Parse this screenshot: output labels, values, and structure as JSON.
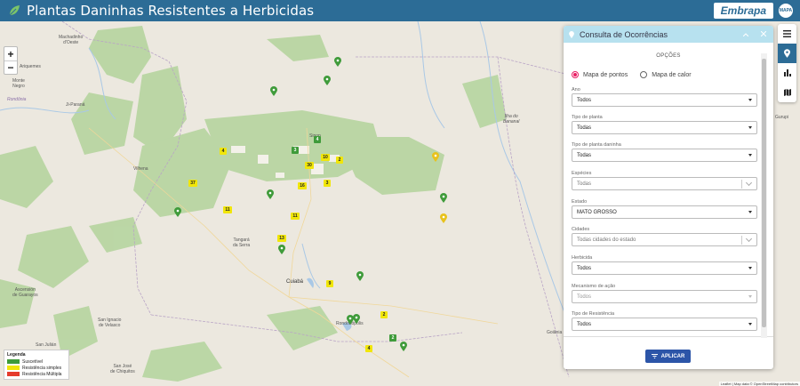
{
  "header": {
    "title": "Plantas Daninhas Resistentes a Herbicidas",
    "brand": "Embrapa",
    "gov_logo": "MAPA"
  },
  "map": {
    "zoom_in": "+",
    "zoom_out": "−",
    "places": [
      {
        "name": "Machadinho\nd'Oeste",
        "big": false
      },
      {
        "name": "Ariquemes",
        "big": false
      },
      {
        "name": "Monte\nNegro",
        "big": false
      },
      {
        "name": "Rondônia",
        "big": false
      },
      {
        "name": "Ji-Paraná",
        "big": false
      },
      {
        "name": "Vilhena",
        "big": false
      },
      {
        "name": "Sinop",
        "big": false
      },
      {
        "name": "Ilha do\nBananal",
        "big": false
      },
      {
        "name": "Tangará\nda Serra",
        "big": false
      },
      {
        "name": "Cuiabá",
        "big": true
      },
      {
        "name": "Rondonópolis",
        "big": false
      },
      {
        "name": "Ascensión\nde Guarayos",
        "big": false
      },
      {
        "name": "San Ignacio\nde Velasco",
        "big": false
      },
      {
        "name": "San Julián",
        "big": false
      },
      {
        "name": "San José\nde Chiquitos",
        "big": false
      },
      {
        "name": "Goiânia",
        "big": false
      },
      {
        "name": "Gurupi",
        "big": false
      }
    ],
    "clusters": [
      {
        "label": "4",
        "color": "y"
      },
      {
        "label": "3",
        "color": "g"
      },
      {
        "label": "4",
        "color": "g"
      },
      {
        "label": "30",
        "color": "y"
      },
      {
        "label": "10",
        "color": "y"
      },
      {
        "label": "2",
        "color": "y"
      },
      {
        "label": "37",
        "color": "y"
      },
      {
        "label": "16",
        "color": "y"
      },
      {
        "label": "3",
        "color": "y"
      },
      {
        "label": "11",
        "color": "y"
      },
      {
        "label": "11",
        "color": "y"
      },
      {
        "label": "13",
        "color": "y"
      },
      {
        "label": "9",
        "color": "y"
      },
      {
        "label": "2",
        "color": "y"
      },
      {
        "label": "2",
        "color": "g"
      },
      {
        "label": "4",
        "color": "y"
      }
    ],
    "legend": {
      "title": "Legenda",
      "items": [
        {
          "label": "Suscetível",
          "color": "#3f9b3a"
        },
        {
          "label": "Resistência simples",
          "color": "#f1e60a"
        },
        {
          "label": "Resistência Múltipla",
          "color": "#e53b2c"
        }
      ]
    },
    "attribution": "Leaflet | Map data © OpenStreetMap contributors"
  },
  "panel": {
    "title": "Consulta de Ocorrências",
    "options_heading": "OPÇÕES",
    "radio_points": "Mapa de pontos",
    "radio_heat": "Mapa de calor",
    "fields": [
      {
        "label": "Ano",
        "value": "Todos",
        "disabled": false
      },
      {
        "label": "Tipo de planta",
        "value": "Todas",
        "disabled": false
      },
      {
        "label": "Tipo de planta daninha",
        "value": "Todas",
        "disabled": false
      },
      {
        "label": "Espécies",
        "value": "Todas",
        "disabled": true
      },
      {
        "label": "Estado",
        "value": "MATO GROSSO",
        "disabled": false
      },
      {
        "label": "Cidades",
        "value": "Todas cidades do estado",
        "disabled": true
      },
      {
        "label": "Herbicida",
        "value": "Todos",
        "disabled": false
      },
      {
        "label": "Mecanismo de ação",
        "value": "Todos",
        "disabled": false
      },
      {
        "label": "Tipo de Resistência",
        "value": "Todos",
        "disabled": false
      }
    ],
    "apply_label": "APLICAR"
  },
  "colors": {
    "header": "#2c6c96",
    "panel_head": "#b7e1ef",
    "apply": "#2c55a8",
    "radio_on": "#e91e63"
  }
}
